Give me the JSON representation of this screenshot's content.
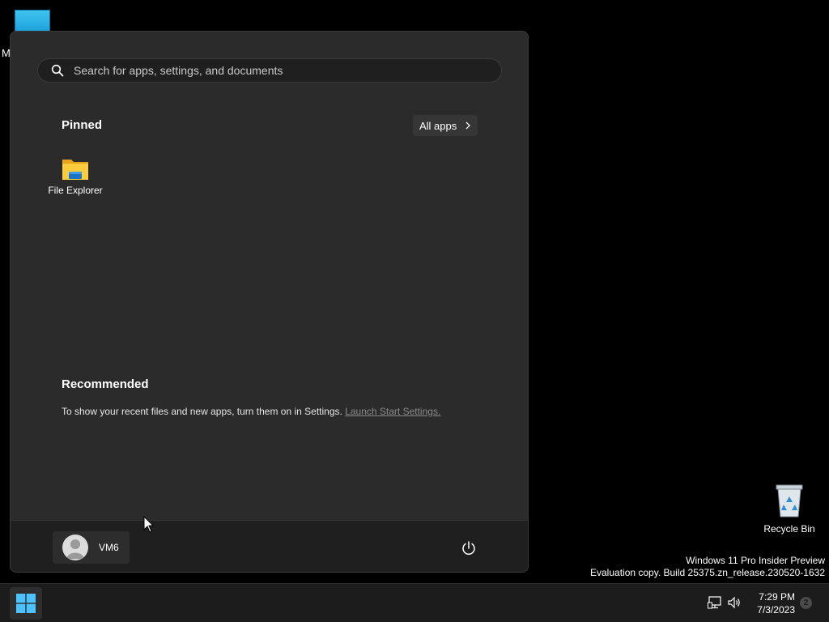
{
  "desktop": {
    "partial_label": "M",
    "recycle_bin_label": "Recycle Bin",
    "watermark_line1": "Windows 11 Pro Insider Preview",
    "watermark_line2": "Evaluation copy. Build 25375.zn_release.230520-1632"
  },
  "start_menu": {
    "search_placeholder": "Search for apps, settings, and documents",
    "pinned_title": "Pinned",
    "all_apps_label": "All apps",
    "pinned_apps": [
      {
        "label": "File Explorer",
        "icon": "folder-icon"
      }
    ],
    "recommended_title": "Recommended",
    "recommended_text": "To show your recent files and new apps, turn them on in Settings.",
    "recommended_link": "Launch Start Settings.",
    "user_name": "VM6"
  },
  "taskbar": {
    "time": "7:29 PM",
    "date": "7/3/2023",
    "notification_count": "2"
  },
  "colors": {
    "accent": "#1aa0d8",
    "start_bg": "#2b2b2b",
    "taskbar_bg": "#1c1c1c"
  }
}
